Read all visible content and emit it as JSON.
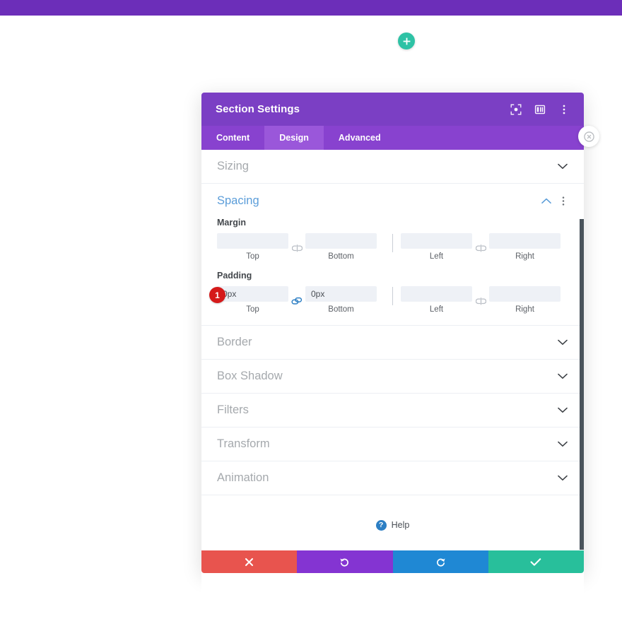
{
  "page": {
    "background_color": "#ffffff",
    "top_bar_color": "#6c2eb9"
  },
  "add_section_button": {
    "icon": "plus-icon",
    "color": "#2ec2a5"
  },
  "modal": {
    "title": "Section Settings",
    "header_color": "#7b3fc4",
    "header_icons": [
      {
        "name": "focus-target-icon"
      },
      {
        "name": "layout-columns-icon"
      },
      {
        "name": "kebab-menu-icon"
      }
    ],
    "tabs": [
      {
        "label": "Content",
        "active": false
      },
      {
        "label": "Design",
        "active": true
      },
      {
        "label": "Advanced",
        "active": false
      }
    ],
    "sections": [
      {
        "label": "Sizing",
        "open": false
      },
      {
        "label": "Spacing",
        "open": true
      },
      {
        "label": "Border",
        "open": false
      },
      {
        "label": "Box Shadow",
        "open": false
      },
      {
        "label": "Filters",
        "open": false
      },
      {
        "label": "Transform",
        "open": false
      },
      {
        "label": "Animation",
        "open": false
      }
    ],
    "spacing": {
      "title": "Spacing",
      "title_color": "#5b9dd9",
      "margin": {
        "label": "Margin",
        "top": {
          "value": "",
          "placeholder": "",
          "sublabel": "Top"
        },
        "bottom": {
          "value": "",
          "placeholder": "",
          "sublabel": "Bottom"
        },
        "left": {
          "value": "",
          "placeholder": "",
          "sublabel": "Left"
        },
        "right": {
          "value": "",
          "placeholder": "",
          "sublabel": "Right"
        },
        "link_top_bottom": "unlinked",
        "link_left_right": "unlinked"
      },
      "padding": {
        "label": "Padding",
        "top": {
          "value": "0px",
          "placeholder": "",
          "sublabel": "Top"
        },
        "bottom": {
          "value": "0px",
          "placeholder": "",
          "sublabel": "Bottom"
        },
        "left": {
          "value": "",
          "placeholder": "",
          "sublabel": "Left"
        },
        "right": {
          "value": "",
          "placeholder": "",
          "sublabel": "Right"
        },
        "link_top_bottom": "linked",
        "link_left_right": "unlinked",
        "badge": "1",
        "badge_color": "#d51a1a"
      }
    },
    "help": {
      "label": "Help",
      "icon": "question-mark-icon",
      "icon_color": "#2d7fc4",
      "icon_glyph": "?"
    },
    "footer_buttons": [
      {
        "name": "discard-button",
        "icon": "close-x-icon",
        "color": "#e8544e"
      },
      {
        "name": "undo-button",
        "icon": "undo-arrow-icon",
        "color": "#8434d2"
      },
      {
        "name": "redo-button",
        "icon": "redo-arrow-icon",
        "color": "#1f88d4"
      },
      {
        "name": "save-button",
        "icon": "checkmark-icon",
        "color": "#28bf9b"
      }
    ]
  },
  "close_pill": {
    "icon": "close-circle-icon"
  }
}
